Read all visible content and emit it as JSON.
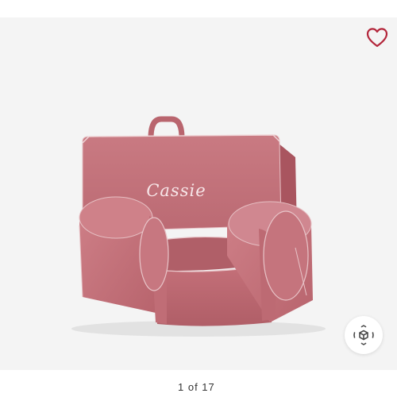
{
  "product": {
    "personalization_text": "Cassie",
    "chair_color": "#c9747c"
  },
  "favorite": {
    "icon": "heart-outline-icon",
    "color": "#b3263b"
  },
  "view_3d": {
    "icon": "3d-cube-icon"
  },
  "image_counter": {
    "text": "1 of 17"
  }
}
